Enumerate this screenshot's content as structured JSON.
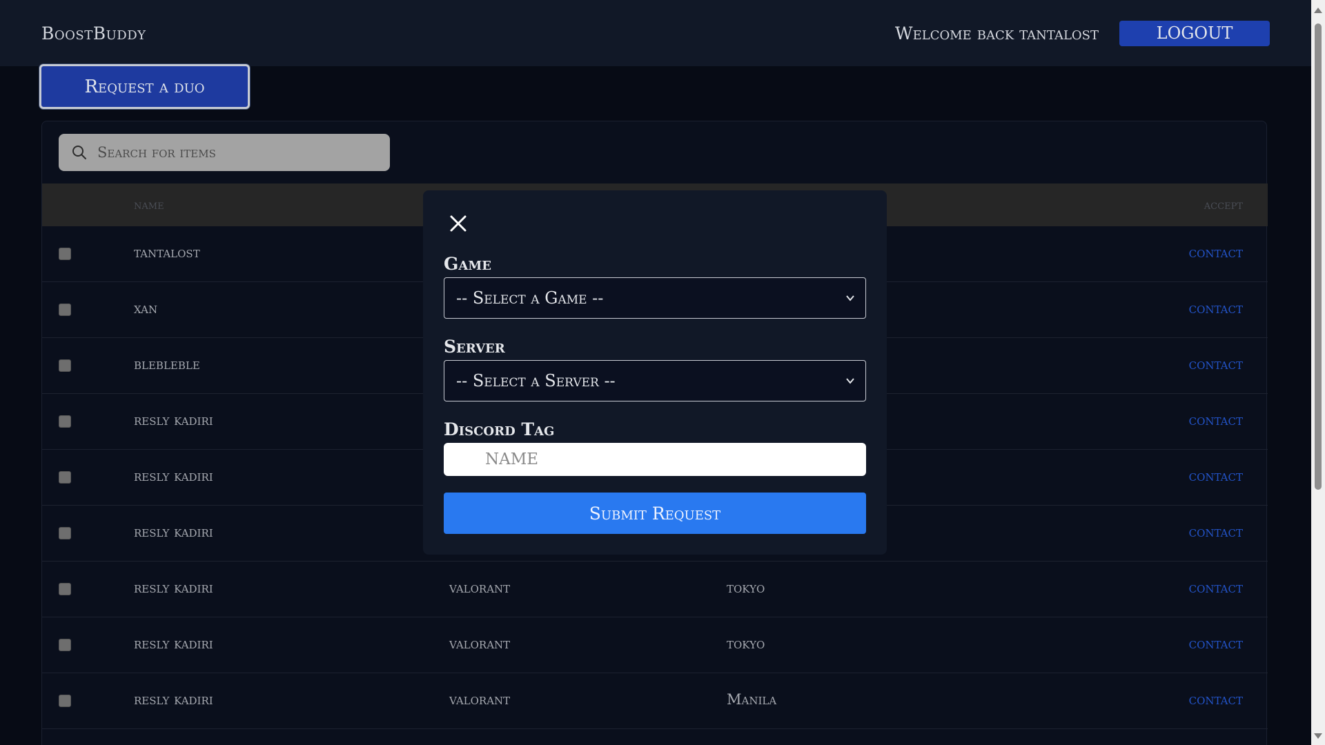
{
  "navbar": {
    "brand": "BoostBuddy",
    "welcome": "Welcome back tantalost",
    "logout_label": "LOGOUT"
  },
  "request_duo_label": "Request a duo",
  "search": {
    "placeholder": "Search for items"
  },
  "table": {
    "headers": {
      "name": "name",
      "accept": "accept"
    },
    "rows": [
      {
        "name": "tantalost",
        "game": "",
        "server": "",
        "action": "contact"
      },
      {
        "name": "xan",
        "game": "",
        "server": "",
        "action": "contact"
      },
      {
        "name": "blebleble",
        "game": "",
        "server": "",
        "action": "contact"
      },
      {
        "name": "resly kadiri",
        "game": "",
        "server": "",
        "action": "contact"
      },
      {
        "name": "resly kadiri",
        "game": "",
        "server": "",
        "action": "contact"
      },
      {
        "name": "resly kadiri",
        "game": "",
        "server": "",
        "action": "contact"
      },
      {
        "name": "resly kadiri",
        "game": "valorant",
        "server": "tokyo",
        "action": "contact"
      },
      {
        "name": "resly kadiri",
        "game": "valorant",
        "server": "tokyo",
        "action": "contact"
      },
      {
        "name": "resly kadiri",
        "game": "valorant",
        "server": "Manila",
        "action": "contact"
      }
    ]
  },
  "modal": {
    "game_label": "Game",
    "game_selected": "-- Select a Game --",
    "server_label": "Server",
    "server_selected": "-- Select a Server --",
    "discord_label": "Discord Tag",
    "discord_placeholder": "NAME",
    "submit_label": "Submit Request"
  },
  "colors": {
    "accent": "#2979f0",
    "nav_button": "#1e40af",
    "link": "#2354c9"
  },
  "icons": [
    "search-icon",
    "close-icon",
    "chevron-down-icon"
  ]
}
